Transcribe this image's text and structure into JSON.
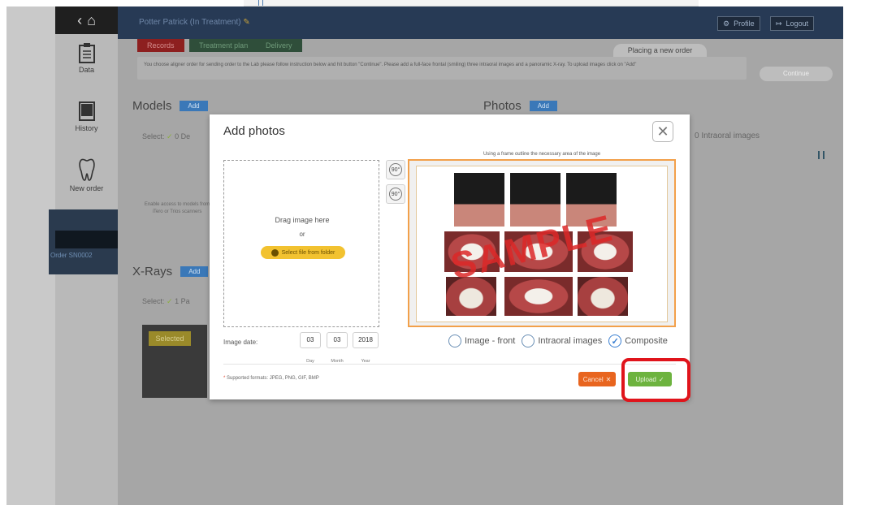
{
  "header": {
    "patient": "Potter Patrick (In Treatment)",
    "profile_label": "Profile",
    "logout_label": "Logout"
  },
  "tabs": [
    "Records",
    "Treatment plan",
    "Delivery"
  ],
  "placing_label": "Placing a new order",
  "info_text": "You choose aligner order for sending order to the Lab please follow instruction below and hit button \"Continue\". Please add a full-face frontal (smiling) three intraoral images and a panoramic X-ray. To upload images click on \"Add\"",
  "continue_label": "Continue",
  "sidebar": {
    "items": [
      {
        "label": "Data",
        "icon": "clipboard-icon"
      },
      {
        "label": "History",
        "icon": "book-icon"
      },
      {
        "label": "New order",
        "icon": "tooth-icon"
      }
    ],
    "order_label": "Order SN0002"
  },
  "sections": {
    "models_title": "Models",
    "photos_title": "Photos",
    "xrays_title": "X-Rays",
    "add_label": "Add",
    "models_select": "Select:",
    "models_count": "0 De",
    "xrays_select": "Select:",
    "xrays_count": "1 Pa",
    "intraoral_text": "0 Intraoral images",
    "scan_note": "Enable access to models from iTero or Trios scanners",
    "selected_badge": "Selected"
  },
  "modal": {
    "title": "Add photos",
    "drag_text": "Drag image here",
    "or_text": "or",
    "select_file_label": "Select file from folder",
    "rotate_right": "90°",
    "rotate_left": "90°",
    "hint": "Using a frame outline the necessary area of the image",
    "sample_text": "SAMPLE",
    "radio_front": "Image - front",
    "radio_intraoral": "Intraoral images",
    "radio_composite": "Composite",
    "selected_radio": "Composite",
    "date_label": "Image date:",
    "day": "03",
    "month": "03",
    "year": "2018",
    "day_label": "Day",
    "month_label": "Month",
    "year_label": "Year",
    "formats": "Supported formats: JPEG, PNG, GIF, BMP",
    "cancel_label": "Cancel",
    "upload_label": "Upload"
  },
  "colors": {
    "accent_highlight": "#e0141b",
    "upload_green": "#6db33f",
    "cancel_orange": "#e8651f",
    "frame_orange": "#f2a04a"
  }
}
